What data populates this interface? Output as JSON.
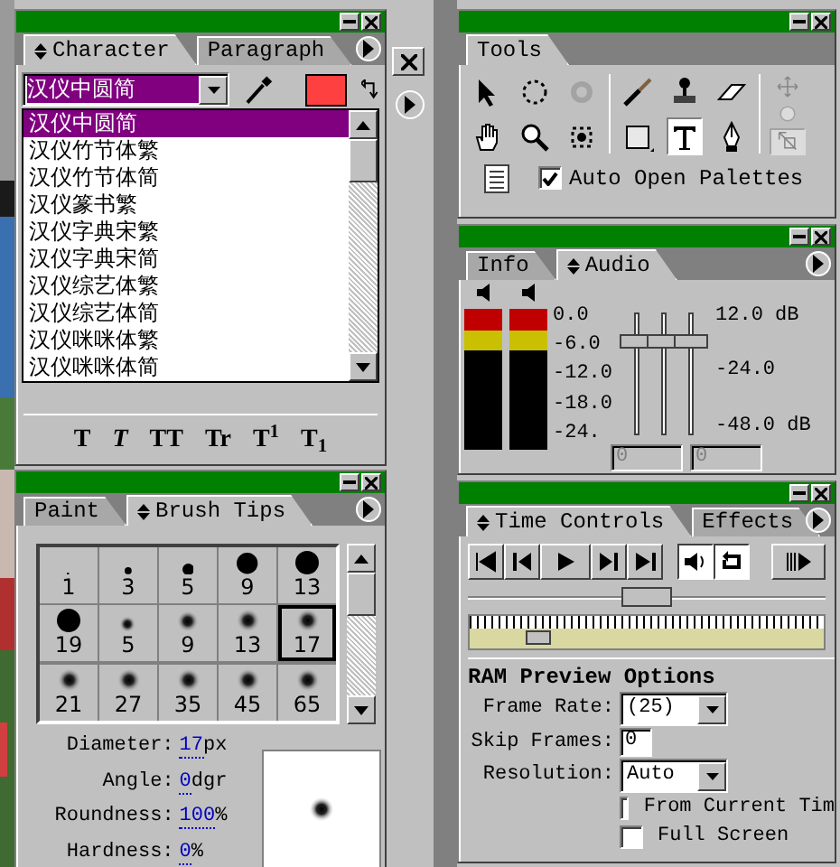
{
  "character_palette": {
    "tabs": [
      {
        "label": "Character",
        "selected": true
      },
      {
        "label": "Paragraph",
        "selected": false
      }
    ],
    "font_field": {
      "value": "汉仪中圆简"
    },
    "font_list": [
      {
        "label": "汉仪中圆简",
        "selected": true
      },
      {
        "label": "汉仪竹节体繁",
        "selected": false
      },
      {
        "label": "汉仪竹节体简",
        "selected": false
      },
      {
        "label": "汉仪篆书繁",
        "selected": false
      },
      {
        "label": "汉仪字典宋繁",
        "selected": false
      },
      {
        "label": "汉仪字典宋简",
        "selected": false
      },
      {
        "label": "汉仪综艺体繁",
        "selected": false
      },
      {
        "label": "汉仪综艺体简",
        "selected": false
      },
      {
        "label": "汉仪咪咪体繁",
        "selected": false
      },
      {
        "label": "汉仪咪咪体简",
        "selected": false
      }
    ],
    "style_buttons": [
      {
        "kind": "bold",
        "label": "T"
      },
      {
        "kind": "italic",
        "label": "T"
      },
      {
        "kind": "all_caps",
        "label": "TT"
      },
      {
        "kind": "small_caps",
        "label": "Tr"
      },
      {
        "kind": "superscript",
        "label": "T$^{1}$"
      },
      {
        "kind": "subscript",
        "label": "T$_{1}$"
      }
    ]
  },
  "brush_palette": {
    "tabs": [
      {
        "label": "Paint",
        "selected": false
      },
      {
        "label": "Brush Tips",
        "selected": true
      }
    ],
    "brushes": [
      {
        "label": "1",
        "kind": "hard",
        "selected": false
      },
      {
        "label": "3",
        "kind": "hard",
        "selected": false
      },
      {
        "label": "5",
        "kind": "hard",
        "selected": false
      },
      {
        "label": "9",
        "kind": "hard",
        "selected": false
      },
      {
        "label": "13",
        "kind": "hard",
        "selected": false
      },
      {
        "label": "19",
        "kind": "hard",
        "selected": false
      },
      {
        "label": "5",
        "kind": "soft",
        "selected": false
      },
      {
        "label": "9",
        "kind": "soft",
        "selected": false
      },
      {
        "label": "13",
        "kind": "soft",
        "selected": false
      },
      {
        "label": "17",
        "kind": "soft",
        "selected": true
      },
      {
        "label": "21",
        "kind": "soft",
        "selected": false
      },
      {
        "label": "27",
        "kind": "soft",
        "selected": false
      },
      {
        "label": "35",
        "kind": "soft",
        "selected": false
      },
      {
        "label": "45",
        "kind": "soft",
        "selected": false
      },
      {
        "label": "65",
        "kind": "soft",
        "selected": false
      }
    ],
    "properties": [
      {
        "label": "Diameter:",
        "value": "17",
        "unit": "px"
      },
      {
        "label": "Angle:",
        "value": "0",
        "unit": "dgr"
      },
      {
        "label": "Roundness:",
        "value": "100",
        "unit": "%"
      },
      {
        "label": "Hardness:",
        "value": "0",
        "unit": "%"
      }
    ]
  },
  "tools_palette": {
    "tabs": [
      {
        "label": "Tools",
        "selected": true
      }
    ],
    "tools": [
      {
        "kind": "selection",
        "selected": false,
        "disabled": false
      },
      {
        "kind": "rotation",
        "selected": false,
        "disabled": false
      },
      {
        "kind": "orbit",
        "selected": false,
        "disabled": true
      },
      {
        "kind": "hand",
        "selected": false,
        "disabled": false
      },
      {
        "kind": "zoom",
        "selected": false,
        "disabled": false
      },
      {
        "kind": "pan_behind",
        "selected": false,
        "disabled": false
      },
      {
        "kind": "brush",
        "selected": false,
        "disabled": false
      },
      {
        "kind": "stamp",
        "selected": false,
        "disabled": false
      },
      {
        "kind": "eraser",
        "selected": false,
        "disabled": false
      },
      {
        "kind": "rectangle",
        "selected": false,
        "disabled": false
      },
      {
        "kind": "text",
        "selected": true,
        "disabled": false
      },
      {
        "kind": "pen",
        "selected": false,
        "disabled": false
      },
      {
        "kind": "move_3d",
        "selected": false,
        "disabled": true
      },
      {
        "kind": "sphere",
        "selected": false,
        "disabled": true
      },
      {
        "kind": "track_z",
        "selected": true,
        "disabled": true
      }
    ],
    "auto_open_palettes": {
      "label": "Auto Open Palettes",
      "checked": true
    }
  },
  "audio_palette": {
    "tabs": [
      {
        "label": "Info",
        "selected": false
      },
      {
        "label": "Audio",
        "selected": true
      }
    ],
    "meter_scale": [
      "0.0",
      "-6.0",
      "-12.0",
      "-18.0",
      "-24."
    ],
    "sliders": [
      {
        "level": 0.78
      },
      {
        "level": 0.78
      },
      {
        "level": 0.78
      }
    ],
    "slider_scale": [
      "12.0 dB",
      "-24.0",
      "-48.0 dB"
    ],
    "fields": [
      "0",
      "0"
    ]
  },
  "time_controls": {
    "tabs": [
      {
        "label": "Time Controls",
        "selected": true
      },
      {
        "label": "Effects",
        "selected": false
      }
    ],
    "buttons": [
      {
        "kind": "first_frame",
        "pressed": false
      },
      {
        "kind": "previous_frame",
        "pressed": false
      },
      {
        "kind": "play",
        "pressed": false
      },
      {
        "kind": "next_frame",
        "pressed": false
      },
      {
        "kind": "last_frame",
        "pressed": false
      },
      {
        "kind": "audio",
        "pressed": true
      },
      {
        "kind": "loop",
        "pressed": true
      },
      {
        "kind": "ram_preview",
        "pressed": false
      }
    ],
    "zoom_slider": {
      "level": 0.5
    },
    "time_ruler": {
      "level": 0.16
    },
    "section_title": "RAM Preview Options",
    "options": [
      {
        "kind": "dropdown",
        "label": "Frame Rate:",
        "value": "(25)"
      },
      {
        "kind": "number",
        "label": "Skip Frames:",
        "value": "0"
      },
      {
        "kind": "dropdown",
        "label": "Resolution:",
        "value": "Auto"
      }
    ],
    "checkboxes": [
      {
        "label": "From Current Tim",
        "checked": false
      },
      {
        "label": "Full Screen",
        "checked": false
      }
    ]
  }
}
